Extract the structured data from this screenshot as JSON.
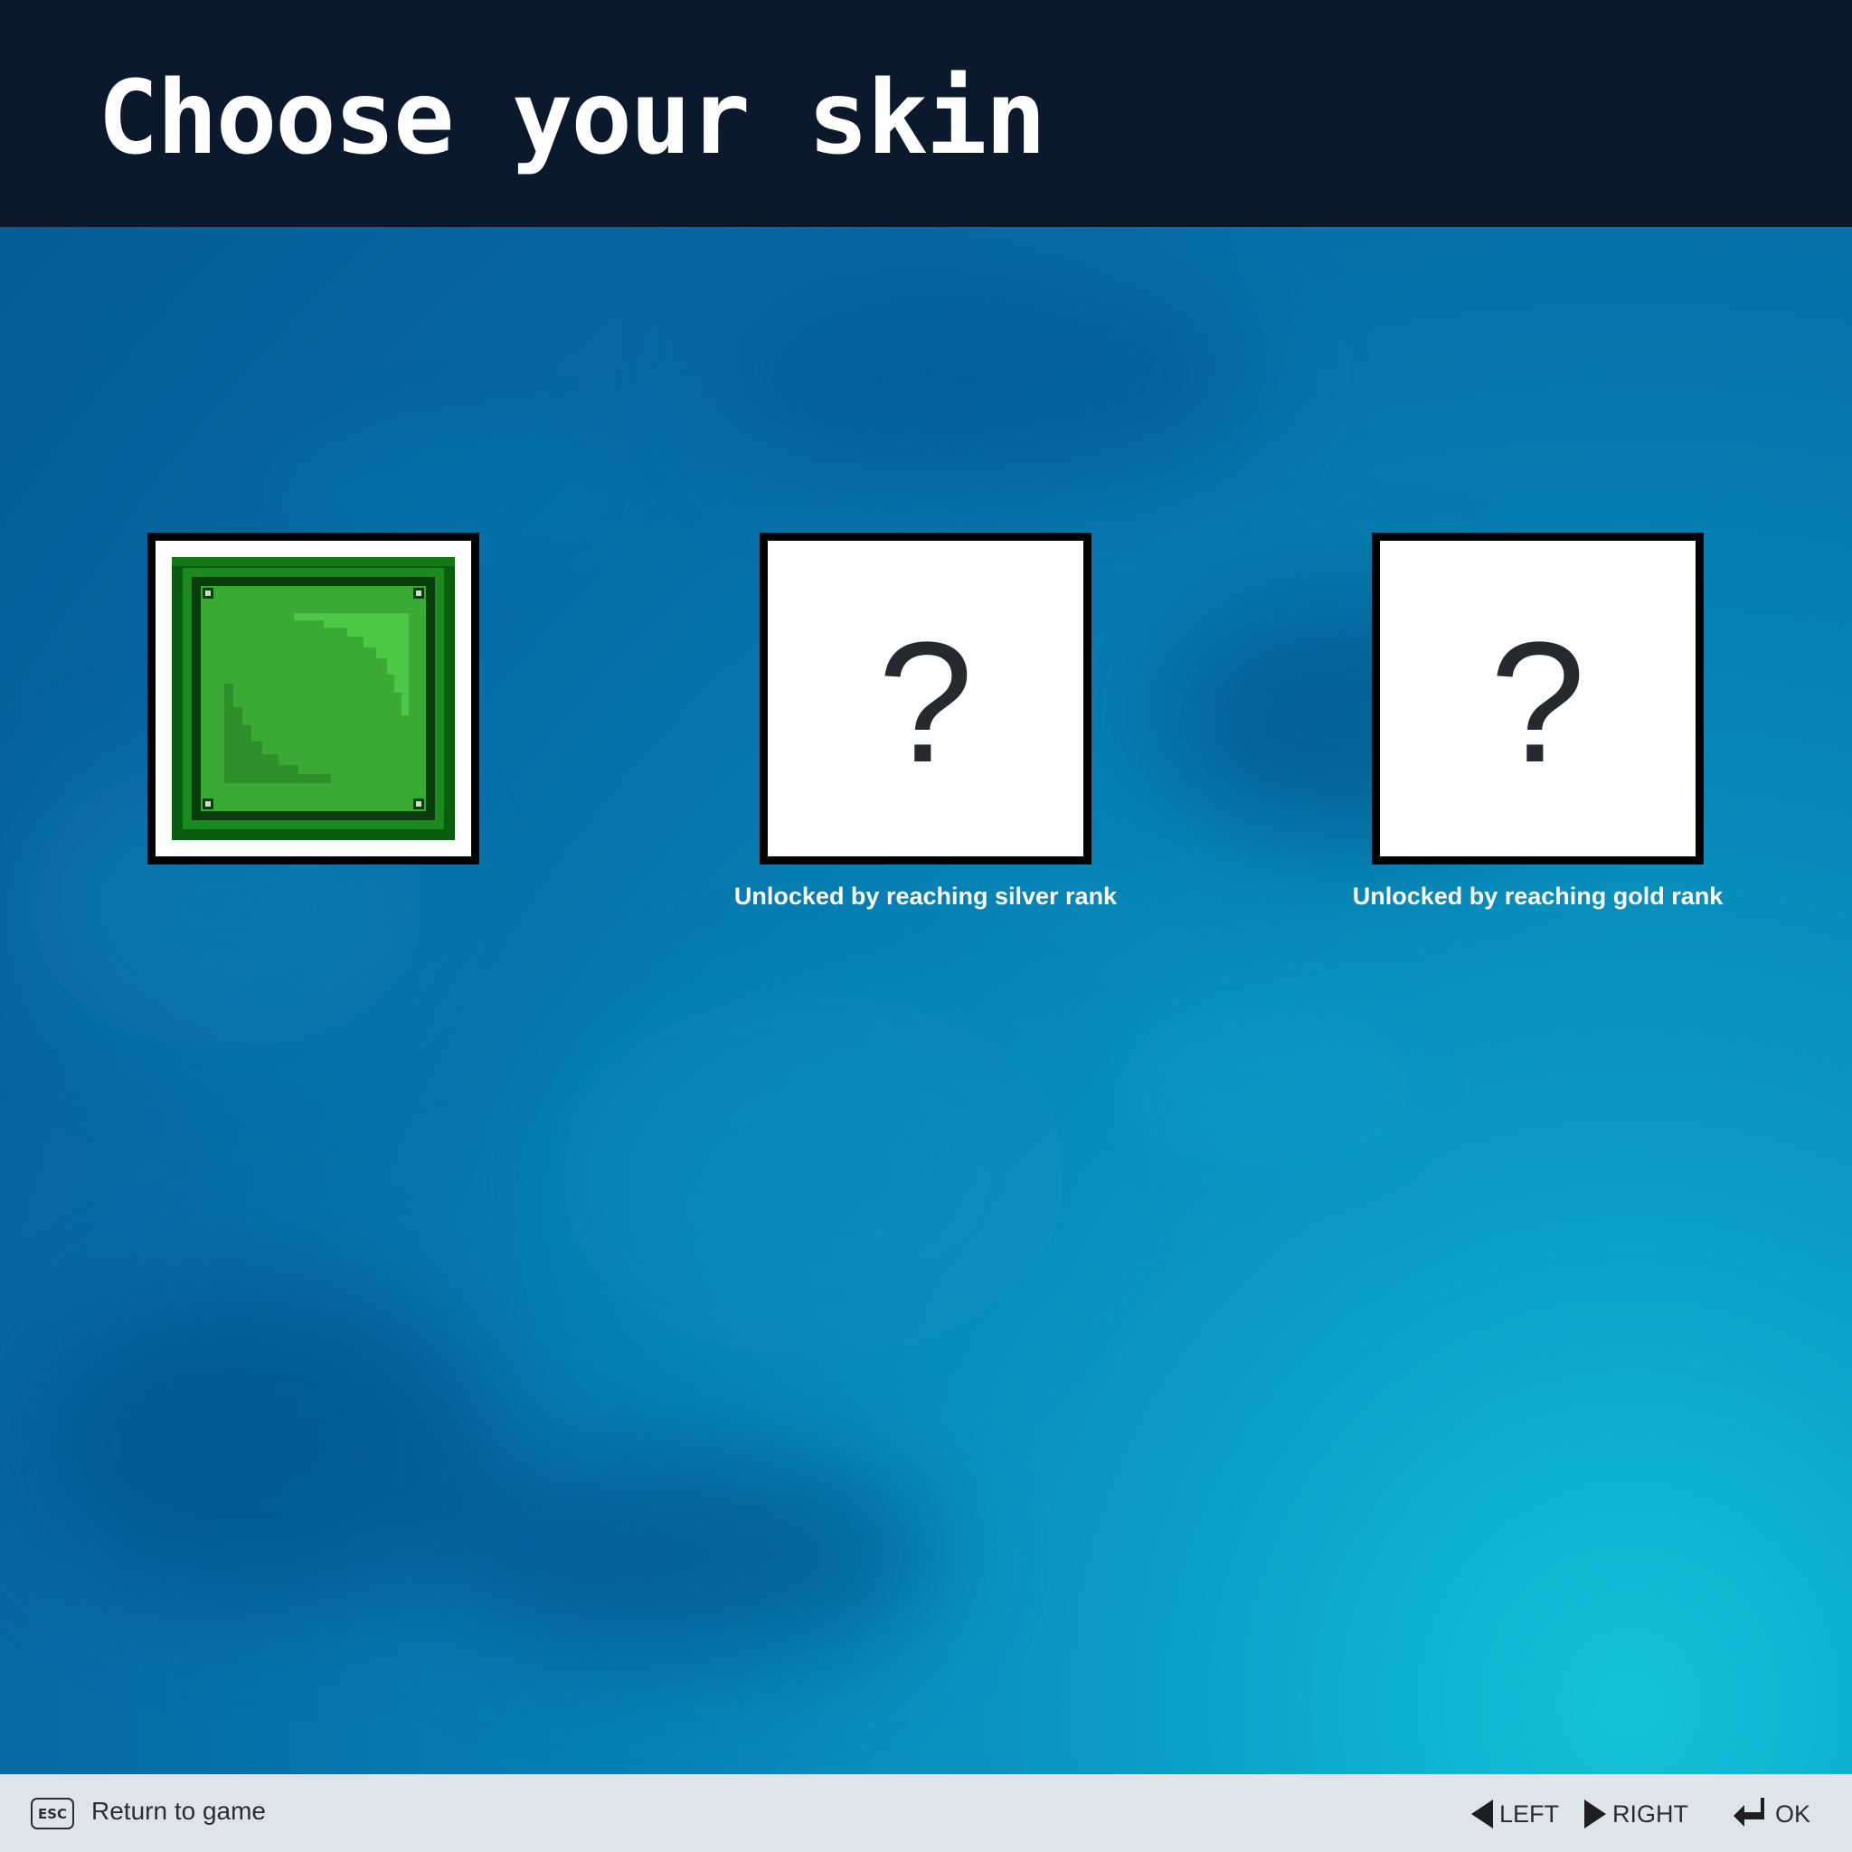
{
  "header": {
    "title": "Choose your skin"
  },
  "skins": [
    {
      "name": "Green block",
      "locked": false,
      "selected": true,
      "unlock_note": ""
    },
    {
      "name": "Mystery skin",
      "locked": true,
      "glyph": "?",
      "unlock_note": "Unlocked by reaching silver rank"
    },
    {
      "name": "Mystery skin",
      "locked": true,
      "glyph": "?",
      "unlock_note": "Unlocked by reaching gold rank"
    }
  ],
  "footer": {
    "esc_key": "ESC",
    "return_label": "Return to game",
    "left_label": "LEFT",
    "right_label": "RIGHT",
    "ok_label": "OK"
  },
  "colors": {
    "header_bg": "#0b192c",
    "footer_bg": "#dee5ea",
    "skin_green_dark": "#0a5c0e",
    "skin_green": "#3aaa35",
    "skin_green_light": "#4dc846"
  }
}
